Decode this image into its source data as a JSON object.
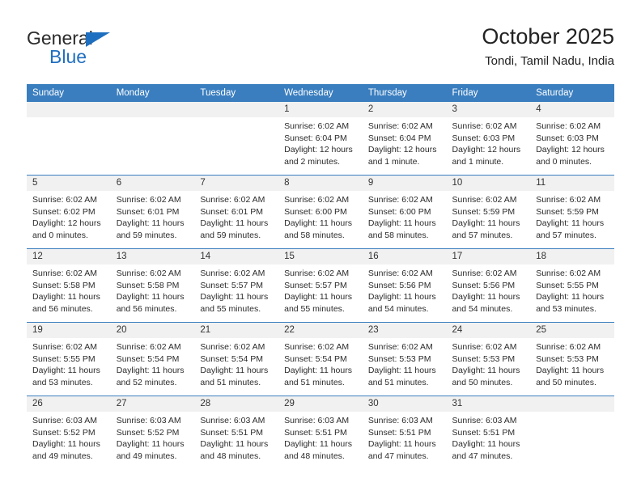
{
  "brand": {
    "name_part1": "General",
    "name_part2": "Blue",
    "accent_color": "#1f6fc0"
  },
  "header": {
    "title": "October 2025",
    "subtitle": "Tondi, Tamil Nadu, India"
  },
  "calendar": {
    "header_bg": "#3a7ebf",
    "daynum_bg": "#f1f1f1",
    "weekday_headers": [
      "Sunday",
      "Monday",
      "Tuesday",
      "Wednesday",
      "Thursday",
      "Friday",
      "Saturday"
    ],
    "weeks": [
      [
        {
          "day": "",
          "sunrise": "",
          "sunset": "",
          "daylight": ""
        },
        {
          "day": "",
          "sunrise": "",
          "sunset": "",
          "daylight": ""
        },
        {
          "day": "",
          "sunrise": "",
          "sunset": "",
          "daylight": ""
        },
        {
          "day": "1",
          "sunrise": "Sunrise: 6:02 AM",
          "sunset": "Sunset: 6:04 PM",
          "daylight": "Daylight: 12 hours and 2 minutes."
        },
        {
          "day": "2",
          "sunrise": "Sunrise: 6:02 AM",
          "sunset": "Sunset: 6:04 PM",
          "daylight": "Daylight: 12 hours and 1 minute."
        },
        {
          "day": "3",
          "sunrise": "Sunrise: 6:02 AM",
          "sunset": "Sunset: 6:03 PM",
          "daylight": "Daylight: 12 hours and 1 minute."
        },
        {
          "day": "4",
          "sunrise": "Sunrise: 6:02 AM",
          "sunset": "Sunset: 6:03 PM",
          "daylight": "Daylight: 12 hours and 0 minutes."
        }
      ],
      [
        {
          "day": "5",
          "sunrise": "Sunrise: 6:02 AM",
          "sunset": "Sunset: 6:02 PM",
          "daylight": "Daylight: 12 hours and 0 minutes."
        },
        {
          "day": "6",
          "sunrise": "Sunrise: 6:02 AM",
          "sunset": "Sunset: 6:01 PM",
          "daylight": "Daylight: 11 hours and 59 minutes."
        },
        {
          "day": "7",
          "sunrise": "Sunrise: 6:02 AM",
          "sunset": "Sunset: 6:01 PM",
          "daylight": "Daylight: 11 hours and 59 minutes."
        },
        {
          "day": "8",
          "sunrise": "Sunrise: 6:02 AM",
          "sunset": "Sunset: 6:00 PM",
          "daylight": "Daylight: 11 hours and 58 minutes."
        },
        {
          "day": "9",
          "sunrise": "Sunrise: 6:02 AM",
          "sunset": "Sunset: 6:00 PM",
          "daylight": "Daylight: 11 hours and 58 minutes."
        },
        {
          "day": "10",
          "sunrise": "Sunrise: 6:02 AM",
          "sunset": "Sunset: 5:59 PM",
          "daylight": "Daylight: 11 hours and 57 minutes."
        },
        {
          "day": "11",
          "sunrise": "Sunrise: 6:02 AM",
          "sunset": "Sunset: 5:59 PM",
          "daylight": "Daylight: 11 hours and 57 minutes."
        }
      ],
      [
        {
          "day": "12",
          "sunrise": "Sunrise: 6:02 AM",
          "sunset": "Sunset: 5:58 PM",
          "daylight": "Daylight: 11 hours and 56 minutes."
        },
        {
          "day": "13",
          "sunrise": "Sunrise: 6:02 AM",
          "sunset": "Sunset: 5:58 PM",
          "daylight": "Daylight: 11 hours and 56 minutes."
        },
        {
          "day": "14",
          "sunrise": "Sunrise: 6:02 AM",
          "sunset": "Sunset: 5:57 PM",
          "daylight": "Daylight: 11 hours and 55 minutes."
        },
        {
          "day": "15",
          "sunrise": "Sunrise: 6:02 AM",
          "sunset": "Sunset: 5:57 PM",
          "daylight": "Daylight: 11 hours and 55 minutes."
        },
        {
          "day": "16",
          "sunrise": "Sunrise: 6:02 AM",
          "sunset": "Sunset: 5:56 PM",
          "daylight": "Daylight: 11 hours and 54 minutes."
        },
        {
          "day": "17",
          "sunrise": "Sunrise: 6:02 AM",
          "sunset": "Sunset: 5:56 PM",
          "daylight": "Daylight: 11 hours and 54 minutes."
        },
        {
          "day": "18",
          "sunrise": "Sunrise: 6:02 AM",
          "sunset": "Sunset: 5:55 PM",
          "daylight": "Daylight: 11 hours and 53 minutes."
        }
      ],
      [
        {
          "day": "19",
          "sunrise": "Sunrise: 6:02 AM",
          "sunset": "Sunset: 5:55 PM",
          "daylight": "Daylight: 11 hours and 53 minutes."
        },
        {
          "day": "20",
          "sunrise": "Sunrise: 6:02 AM",
          "sunset": "Sunset: 5:54 PM",
          "daylight": "Daylight: 11 hours and 52 minutes."
        },
        {
          "day": "21",
          "sunrise": "Sunrise: 6:02 AM",
          "sunset": "Sunset: 5:54 PM",
          "daylight": "Daylight: 11 hours and 51 minutes."
        },
        {
          "day": "22",
          "sunrise": "Sunrise: 6:02 AM",
          "sunset": "Sunset: 5:54 PM",
          "daylight": "Daylight: 11 hours and 51 minutes."
        },
        {
          "day": "23",
          "sunrise": "Sunrise: 6:02 AM",
          "sunset": "Sunset: 5:53 PM",
          "daylight": "Daylight: 11 hours and 51 minutes."
        },
        {
          "day": "24",
          "sunrise": "Sunrise: 6:02 AM",
          "sunset": "Sunset: 5:53 PM",
          "daylight": "Daylight: 11 hours and 50 minutes."
        },
        {
          "day": "25",
          "sunrise": "Sunrise: 6:02 AM",
          "sunset": "Sunset: 5:53 PM",
          "daylight": "Daylight: 11 hours and 50 minutes."
        }
      ],
      [
        {
          "day": "26",
          "sunrise": "Sunrise: 6:03 AM",
          "sunset": "Sunset: 5:52 PM",
          "daylight": "Daylight: 11 hours and 49 minutes."
        },
        {
          "day": "27",
          "sunrise": "Sunrise: 6:03 AM",
          "sunset": "Sunset: 5:52 PM",
          "daylight": "Daylight: 11 hours and 49 minutes."
        },
        {
          "day": "28",
          "sunrise": "Sunrise: 6:03 AM",
          "sunset": "Sunset: 5:51 PM",
          "daylight": "Daylight: 11 hours and 48 minutes."
        },
        {
          "day": "29",
          "sunrise": "Sunrise: 6:03 AM",
          "sunset": "Sunset: 5:51 PM",
          "daylight": "Daylight: 11 hours and 48 minutes."
        },
        {
          "day": "30",
          "sunrise": "Sunrise: 6:03 AM",
          "sunset": "Sunset: 5:51 PM",
          "daylight": "Daylight: 11 hours and 47 minutes."
        },
        {
          "day": "31",
          "sunrise": "Sunrise: 6:03 AM",
          "sunset": "Sunset: 5:51 PM",
          "daylight": "Daylight: 11 hours and 47 minutes."
        },
        {
          "day": "",
          "sunrise": "",
          "sunset": "",
          "daylight": ""
        }
      ]
    ]
  }
}
